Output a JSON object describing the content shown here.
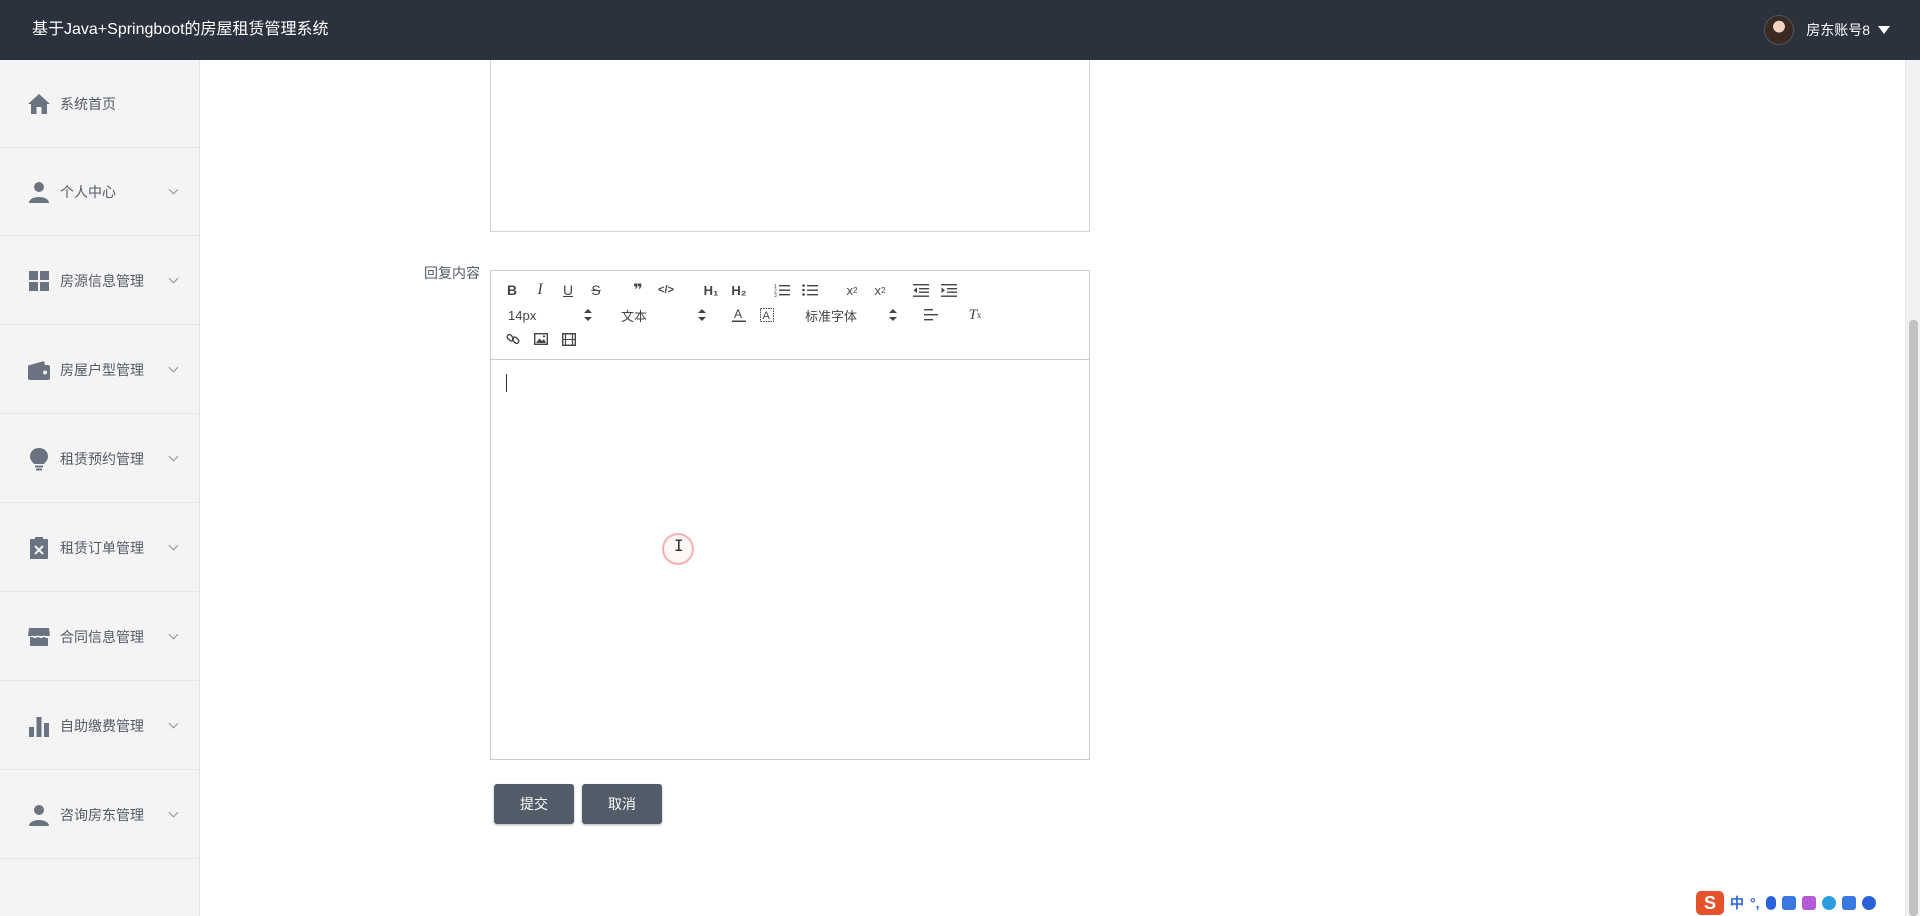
{
  "header": {
    "title": "基于Java+Springboot的房屋租赁管理系统",
    "username": "房东账号8"
  },
  "sidebar": {
    "items": [
      {
        "label": "系统首页",
        "icon": "home-icon"
      },
      {
        "label": "个人中心",
        "icon": "person-icon"
      },
      {
        "label": "房源信息管理",
        "icon": "grid-icon"
      },
      {
        "label": "房屋户型管理",
        "icon": "wallet-icon"
      },
      {
        "label": "租赁预约管理",
        "icon": "bulb-icon"
      },
      {
        "label": "租赁订单管理",
        "icon": "clipboard-icon"
      },
      {
        "label": "合同信息管理",
        "icon": "store-icon"
      },
      {
        "label": "自助缴费管理",
        "icon": "bar-chart-icon"
      },
      {
        "label": "咨询房东管理",
        "icon": "person-icon"
      }
    ]
  },
  "form": {
    "reply_label": "回复内容",
    "font_size": "14px",
    "text_format": "文本",
    "font_family": "标准字体",
    "submit_label": "提交",
    "cancel_label": "取消"
  },
  "ime": {
    "logo": "S",
    "mode": "中"
  }
}
